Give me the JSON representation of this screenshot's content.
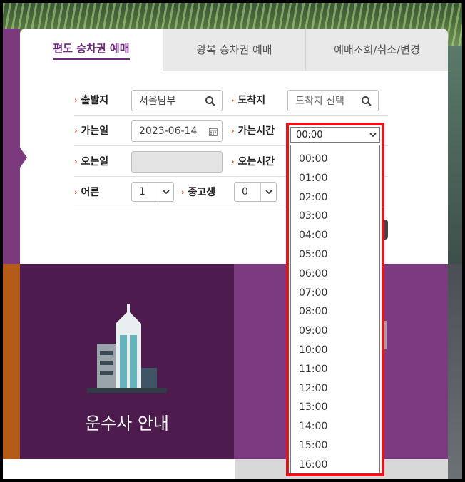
{
  "tabs": [
    {
      "label": "편도 승차권 예매",
      "active": true
    },
    {
      "label": "왕복 승차권 예매",
      "active": false
    },
    {
      "label": "예매조회/취소/변경",
      "active": false
    }
  ],
  "form": {
    "departure": {
      "label": "출발지",
      "value": "서울남부"
    },
    "arrival": {
      "label": "도착지",
      "placeholder": "도착지 선택"
    },
    "depart_date": {
      "label": "가는일",
      "value": "2023-06-14"
    },
    "depart_time": {
      "label": "가는시간"
    },
    "return_date": {
      "label": "오는일",
      "value": ""
    },
    "return_time": {
      "label": "오는시간"
    },
    "adult": {
      "label": "어른",
      "value": "1"
    },
    "youth": {
      "label": "중고생",
      "value": "0"
    }
  },
  "dropdown": {
    "selected": "00:00",
    "options": [
      "00:00",
      "01:00",
      "02:00",
      "03:00",
      "04:00",
      "05:00",
      "06:00",
      "07:00",
      "08:00",
      "09:00",
      "10:00",
      "11:00",
      "12:00",
      "13:00",
      "14:00",
      "15:00",
      "16:00"
    ]
  },
  "bottom": {
    "left_title": "운수사 안내",
    "mid_title_fragment": "l"
  },
  "colors": {
    "brand_purple": "#6e2a7a",
    "dark_purple": "#4d1b4e",
    "mid_purple": "#7c3a80",
    "orange": "#b35c19",
    "highlight_red": "#e5131a",
    "label_arrow": "#d1561a"
  },
  "icons": {
    "search": "search-icon",
    "calendar": "calendar-icon",
    "chevron": "chevron-down-icon",
    "building": "building-icon"
  }
}
